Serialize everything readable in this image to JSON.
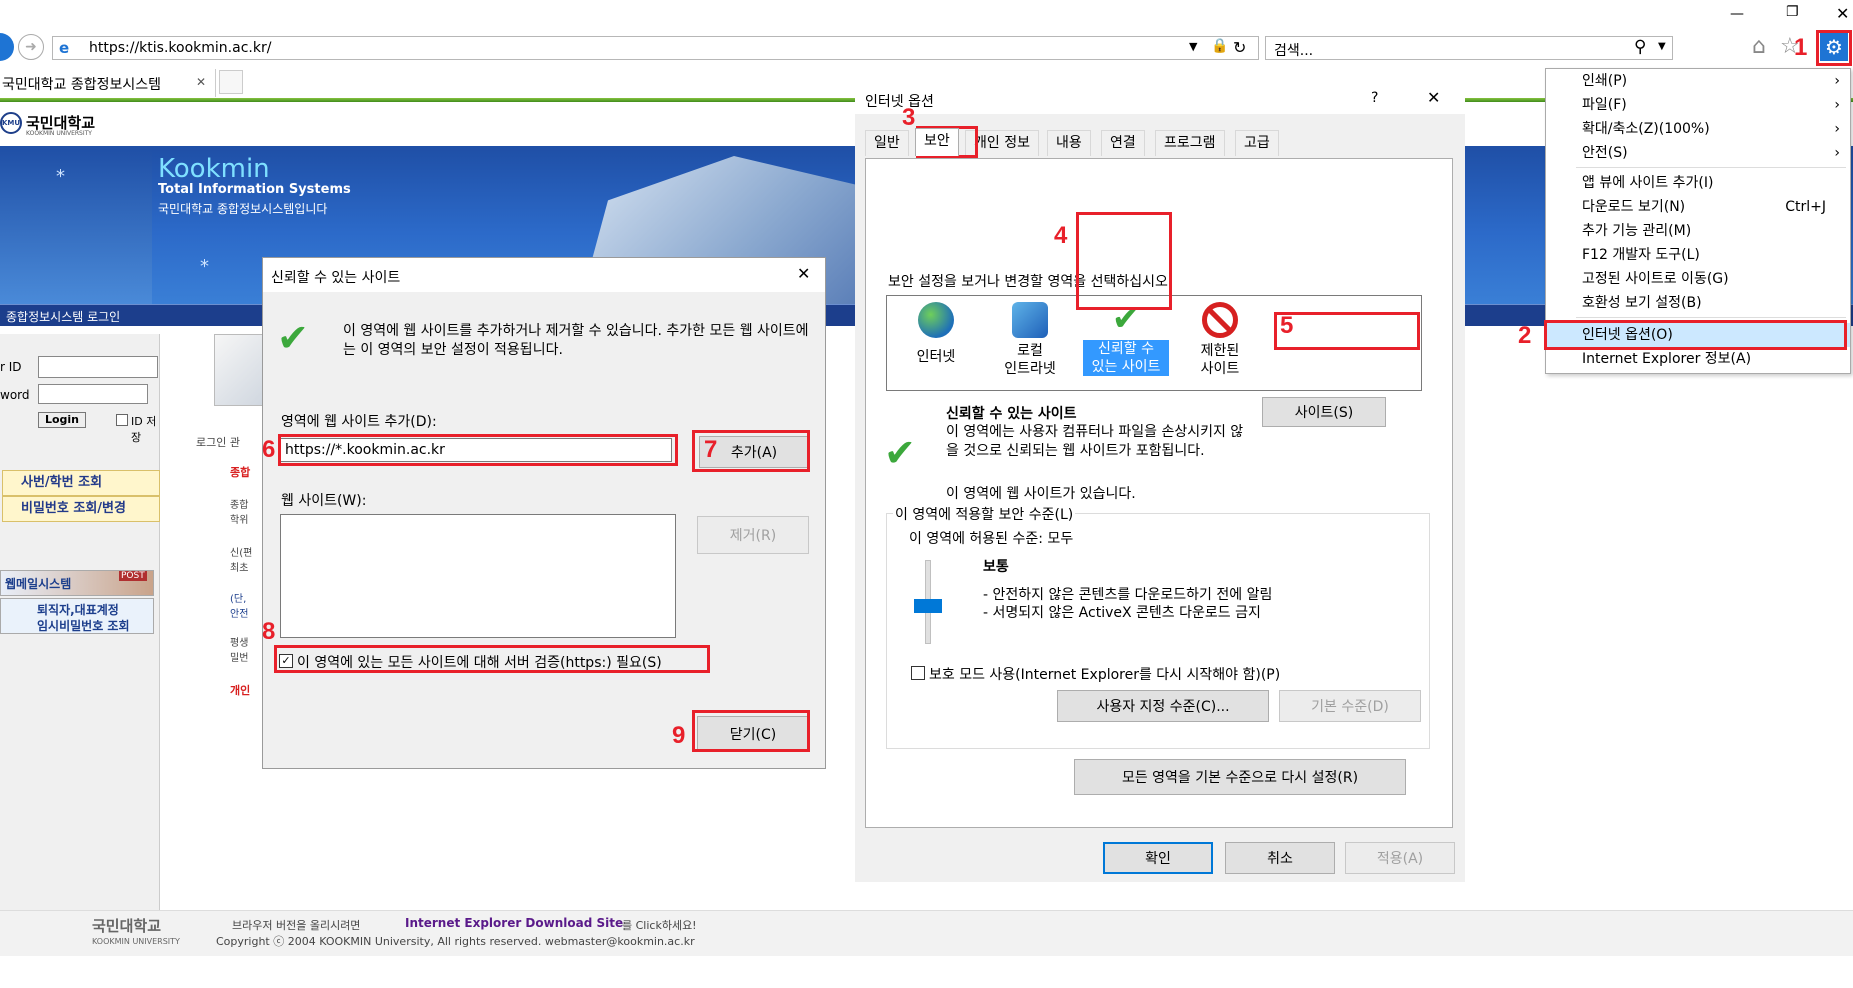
{
  "browser": {
    "url": "https://ktis.kookmin.ac.kr/",
    "search_placeholder": "검색...",
    "tab_title": "국민대학교 종합정보시스템",
    "tab_close": "✕"
  },
  "ie_menu": {
    "items": [
      {
        "label": "인쇄(P)",
        "arrow": "›"
      },
      {
        "label": "파일(F)",
        "arrow": "›"
      },
      {
        "label": "확대/축소(Z)(100%)",
        "arrow": "›"
      },
      {
        "label": "안전(S)",
        "arrow": "›"
      },
      {
        "label": "앱 뷰에 사이트 추가(I)"
      },
      {
        "label": "다운로드 보기(N)",
        "shortcut": "Ctrl+J"
      },
      {
        "label": "추가 기능 관리(M)"
      },
      {
        "label": "F12 개발자 도구(L)"
      },
      {
        "label": "고정된 사이트로 이동(G)"
      },
      {
        "label": "호환성 보기 설정(B)"
      },
      {
        "label": "인터넷 옵션(O)"
      },
      {
        "label": "Internet Explorer 정보(A)"
      }
    ]
  },
  "site": {
    "logo_text": "국민대학교",
    "logo_sub": "KOOKMIN UNIVERSITY",
    "banner_title": "Kookmin",
    "banner_subtitle": "Total Information Systems",
    "banner_desc": "국민대학교 종합정보시스템입니다",
    "login_bar": "종합정보시스템 로그인",
    "id_label": "r ID",
    "pw_label": "word",
    "login_button": "Login",
    "id_save": "ID 저장",
    "link_studentno": "사번/학번 조회",
    "link_password": "비밀번호 조회/변경",
    "webmail_label": "웹메일시스템",
    "webmail_post": "POST",
    "retire_line1": "퇴직자,대표계정",
    "retire_line2": "임시비밀번호 조회",
    "notice_header": "로그인 관",
    "notice_items": [
      "종합",
      "종합\n학위",
      "신(편\n최초",
      "(단,\n안전",
      "평생\n밀번",
      "개인"
    ],
    "footer_logo": "국민대학교",
    "footer_logo_sub": "KOOKMIN UNIVERSITY",
    "footer_line1_pre": "브라우저 버전을 올리시려면",
    "footer_line1_link": "Internet Explorer Download Site",
    "footer_line1_post": "를 Click하세요!",
    "footer_line2": "Copyright ⓒ 2004 KOOKMIN University, All rights reserved. webmaster@kookmin.ac.kr"
  },
  "trusted_dialog": {
    "title": "신뢰할 수 있는 사이트",
    "description": "이 영역에 웹 사이트를 추가하거나 제거할 수 있습니다. 추가한 모든 웹 사이트에는 이 영역의 보안 설정이 적용됩니다.",
    "add_label": "영역에 웹 사이트 추가(D):",
    "add_value": "https://*.kookmin.ac.kr",
    "add_button": "추가(A)",
    "sites_label": "웹 사이트(W):",
    "remove_button": "제거(R)",
    "https_checkbox": "이 영역에 있는 모든 사이트에 대해 서버 검증(https:) 필요(S)",
    "close_button": "닫기(C)"
  },
  "options_dialog": {
    "title": "인터넷 옵션",
    "help": "?",
    "tabs": [
      "일반",
      "보안",
      "개인 정보",
      "내용",
      "연결",
      "프로그램",
      "고급"
    ],
    "instruction": "보안 설정을 보거나 변경할 영역을 선택하십시오.",
    "zones": [
      {
        "label": "인터넷"
      },
      {
        "label": "로컬\n인트라넷"
      },
      {
        "label": "신뢰할 수\n있는 사이트"
      },
      {
        "label": "제한된\n사이트"
      }
    ],
    "zone_title": "신뢰할 수 있는 사이트",
    "zone_desc": "이 영역에는 사용자 컴퓨터나 파일을 손상시키지 않을 것으로 신뢰되는 웹 사이트가 포함됩니다.",
    "zone_has_sites": "이 영역에 웹 사이트가 있습니다.",
    "sites_button": "사이트(S)",
    "level_group": "이 영역에 적용할 보안 수준(L)",
    "allowed_level": "이 영역에 허용된 수준: 모두",
    "level_name": "보통",
    "level_bullet1": "- 안전하지 않은 콘텐츠를 다운로드하기 전에 알림",
    "level_bullet2": "- 서명되지 않은 ActiveX 콘텐츠 다운로드 금지",
    "protected_mode": "보호 모드 사용(Internet Explorer를 다시 시작해야 함)(P)",
    "custom_button": "사용자 지정 수준(C)...",
    "default_button": "기본 수준(D)",
    "reset_all_button": "모든 영역을 기본 수준으로 다시 설정(R)",
    "ok": "확인",
    "cancel": "취소",
    "apply": "적용(A)"
  },
  "annotations": {
    "s1": "1",
    "s2": "2",
    "s3": "3",
    "s4": "4",
    "s5": "5",
    "s6": "6",
    "s7": "7",
    "s8": "8",
    "s9": "9"
  },
  "colors": {
    "annotation": "#e8202a",
    "banner_blue": "#1e5fb8",
    "ie_blue": "#1e74d4",
    "selected_menu": "#cce8ff"
  }
}
